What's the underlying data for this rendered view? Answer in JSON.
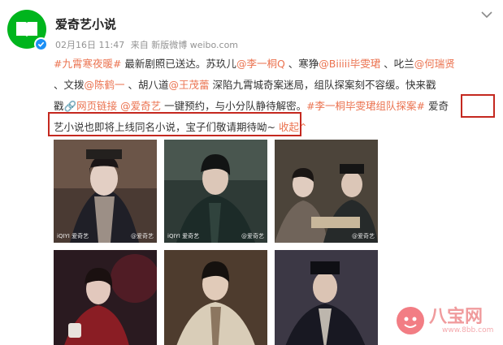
{
  "post": {
    "user_name": "爱奇艺小说",
    "date": "02月16日 11:47",
    "source": "来自 新版微博 weibo.com",
    "lines": [
      [
        {
          "t": "#九霄寒夜暖#",
          "link": true
        },
        {
          "t": " 最新剧照已送达。苏玖儿",
          "link": false
        },
        {
          "t": "@李一桐Q",
          "link": true
        },
        {
          "t": " 、寒狰",
          "link": false
        },
        {
          "t": "@Biiiii毕雯珺",
          "link": true
        },
        {
          "t": " 、叱兰",
          "link": false
        },
        {
          "t": "@何瑞贤",
          "link": true
        }
      ],
      [
        {
          "t": "、文拨",
          "link": false
        },
        {
          "t": "@陈鹤一",
          "link": true
        },
        {
          "t": " 、胡八道",
          "link": false
        },
        {
          "t": "@王茂蕾",
          "link": true
        },
        {
          "t": " 深陷九霄城奇案迷局，组队探案刻不容缓。快来戳",
          "link": false
        }
      ],
      [
        {
          "t": "戳",
          "link": false
        },
        {
          "t": "🔗网页链接",
          "link": true
        },
        {
          "t": " ",
          "link": false
        },
        {
          "t": "@爱奇艺",
          "link": true
        },
        {
          "t": " 一键预约，与小分队静待解密。",
          "link": false
        },
        {
          "t": "#李一桐毕雯珺组队探案#",
          "link": true
        },
        {
          "t": " 爱奇",
          "link": false
        }
      ],
      [
        {
          "t": "艺小说也即将上线同名小说，宝子们敬请期待呦~ ",
          "link": false
        },
        {
          "t": "收起",
          "link": true
        },
        {
          "t": "⌃",
          "link": true
        }
      ]
    ]
  },
  "photos": [
    {
      "watermark": "iQIYI 爱奇艺",
      "credit": "@爱奇艺"
    },
    {
      "watermark": "iQIYI 爱奇艺",
      "credit": "@爱奇艺"
    },
    {
      "watermark": "",
      "credit": "@爱奇艺"
    },
    {
      "watermark": "",
      "credit": ""
    },
    {
      "watermark": "",
      "credit": ""
    },
    {
      "watermark": "",
      "credit": ""
    }
  ],
  "site_logo": {
    "text": "八宝网",
    "url": "www.8bb.com"
  },
  "colors": {
    "link": "#eb7350",
    "highlight_box": "#c4281f",
    "avatar_bg": "#00b51d",
    "verified": "#1b8ff5"
  }
}
